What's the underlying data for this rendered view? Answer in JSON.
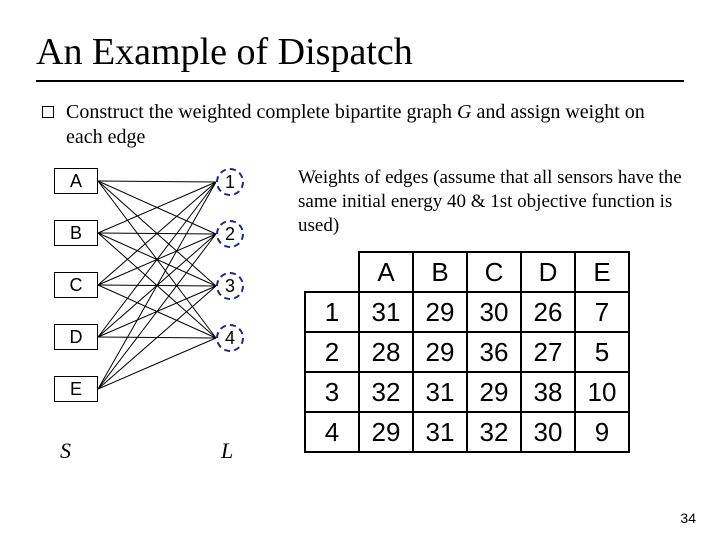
{
  "title": "An Example of Dispatch",
  "bullet": {
    "pre": "Construct the ",
    "mid": "weighted complete bipartite graph ",
    "graph_sym": "G",
    "post": " and assign weight on each edge"
  },
  "graph": {
    "left_nodes": [
      "A",
      "B",
      "C",
      "D",
      "E"
    ],
    "right_nodes": [
      "1",
      "2",
      "3",
      "4"
    ],
    "left_set_label": "S",
    "right_set_label": "L"
  },
  "weights_caption": "Weights of edges (assume that all sensors have the same initial energy 40 & 1st objective function is used)",
  "table": {
    "cols": [
      "A",
      "B",
      "C",
      "D",
      "E"
    ],
    "rows": [
      "1",
      "2",
      "3",
      "4"
    ],
    "data": [
      [
        31,
        29,
        30,
        26,
        7
      ],
      [
        28,
        29,
        36,
        27,
        5
      ],
      [
        32,
        31,
        29,
        38,
        10
      ],
      [
        29,
        31,
        32,
        30,
        9
      ]
    ]
  },
  "page_number": "34",
  "chart_data": {
    "type": "table",
    "title": "Edge weights of bipartite graph G (initial energy 40, 1st objective)",
    "row_labels": [
      "1",
      "2",
      "3",
      "4"
    ],
    "col_labels": [
      "A",
      "B",
      "C",
      "D",
      "E"
    ],
    "values": [
      [
        31,
        29,
        30,
        26,
        7
      ],
      [
        28,
        29,
        36,
        27,
        5
      ],
      [
        32,
        31,
        29,
        38,
        10
      ],
      [
        29,
        31,
        32,
        30,
        9
      ]
    ]
  }
}
